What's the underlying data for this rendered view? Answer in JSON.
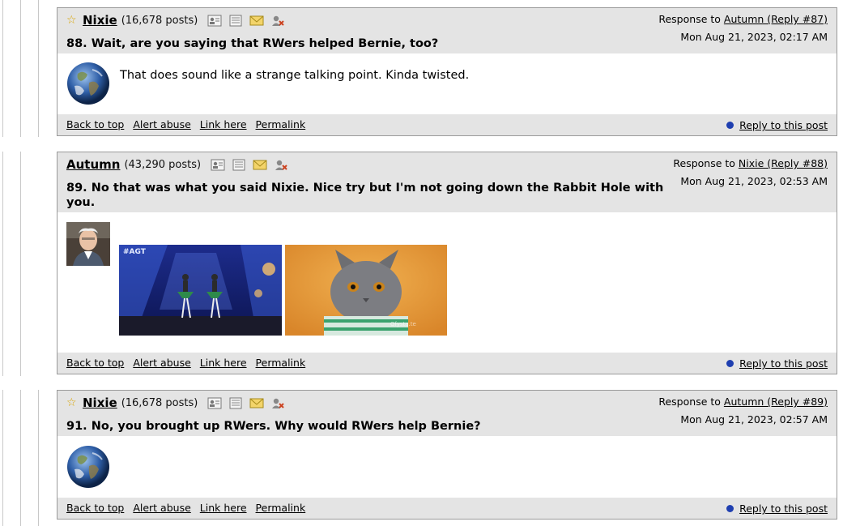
{
  "footer_links": {
    "back_to_top": "Back to top",
    "alert_abuse": "Alert abuse",
    "link_here": "Link here",
    "permalink": "Permalink",
    "reply": "Reply to this post"
  },
  "posts": [
    {
      "author": "Nixie",
      "post_count": "(16,678 posts)",
      "title": "88. Wait, are you saying that RWers helped Bernie, too?",
      "response_prefix": "Response to ",
      "response_to": "Autumn (Reply #87)",
      "date": "Mon Aug 21, 2023, 02:17 AM",
      "body": "That does sound like a strange talking point. Kinda twisted.",
      "starred": true,
      "avatar": "earth-globe"
    },
    {
      "author": "Autumn",
      "post_count": "(43,290 posts)",
      "title": "89. No that was what you said Nixie. Nice try but I'm not going down the Rabbit Hole with you.",
      "response_prefix": "Response to ",
      "response_to": "Nixie (Reply #88)",
      "date": "Mon Aug 21, 2023, 02:53 AM",
      "body": "",
      "starred": false,
      "avatar": "bernie-photo",
      "gif1_watermark": "#AGT",
      "gif2_watermark": "Gfysta.te"
    },
    {
      "author": "Nixie",
      "post_count": "(16,678 posts)",
      "title": "91. No, you brought up RWers. Why would RWers help Bernie?",
      "response_prefix": "Response to ",
      "response_to": "Autumn (Reply #89)",
      "date": "Mon Aug 21, 2023, 02:57 AM",
      "body": "",
      "starred": true,
      "avatar": "earth-globe"
    }
  ],
  "colors": {
    "header_bg": "#e4e4e4",
    "border": "#9a9a9a",
    "reply_dot": "#1f3fb0",
    "star": "#d8a400"
  }
}
